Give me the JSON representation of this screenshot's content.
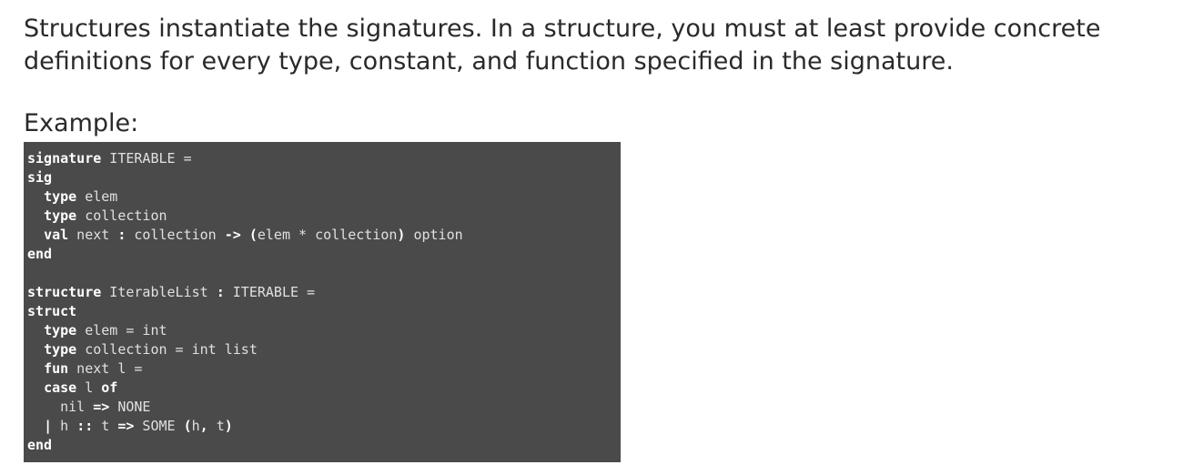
{
  "intro_text": "Structures instantiate the signatures. In a structure, you must at least provide concrete definitions for every type, constant, and function specified in the signature.",
  "example_label": "Example:",
  "code_lines": [
    [
      {
        "kw": true,
        "text": "signature"
      },
      {
        "kw": false,
        "text": " ITERABLE ="
      }
    ],
    [
      {
        "kw": true,
        "text": "sig"
      }
    ],
    [
      {
        "kw": false,
        "text": "  "
      },
      {
        "kw": true,
        "text": "type"
      },
      {
        "kw": false,
        "text": " elem"
      }
    ],
    [
      {
        "kw": false,
        "text": "  "
      },
      {
        "kw": true,
        "text": "type"
      },
      {
        "kw": false,
        "text": " collection"
      }
    ],
    [
      {
        "kw": false,
        "text": "  "
      },
      {
        "kw": true,
        "text": "val"
      },
      {
        "kw": false,
        "text": " next "
      },
      {
        "kw": true,
        "text": ":"
      },
      {
        "kw": false,
        "text": " collection "
      },
      {
        "kw": true,
        "text": "->"
      },
      {
        "kw": false,
        "text": " "
      },
      {
        "kw": true,
        "text": "("
      },
      {
        "kw": false,
        "text": "elem * collection"
      },
      {
        "kw": true,
        "text": ")"
      },
      {
        "kw": false,
        "text": " option"
      }
    ],
    [
      {
        "kw": true,
        "text": "end"
      }
    ],
    [],
    [
      {
        "kw": true,
        "text": "structure"
      },
      {
        "kw": false,
        "text": " IterableList "
      },
      {
        "kw": true,
        "text": ":"
      },
      {
        "kw": false,
        "text": " ITERABLE ="
      }
    ],
    [
      {
        "kw": true,
        "text": "struct"
      }
    ],
    [
      {
        "kw": false,
        "text": "  "
      },
      {
        "kw": true,
        "text": "type"
      },
      {
        "kw": false,
        "text": " elem = int"
      }
    ],
    [
      {
        "kw": false,
        "text": "  "
      },
      {
        "kw": true,
        "text": "type"
      },
      {
        "kw": false,
        "text": " collection = int list"
      }
    ],
    [
      {
        "kw": false,
        "text": "  "
      },
      {
        "kw": true,
        "text": "fun"
      },
      {
        "kw": false,
        "text": " next l ="
      }
    ],
    [
      {
        "kw": false,
        "text": "  "
      },
      {
        "kw": true,
        "text": "case"
      },
      {
        "kw": false,
        "text": " l "
      },
      {
        "kw": true,
        "text": "of"
      }
    ],
    [
      {
        "kw": false,
        "text": "    nil "
      },
      {
        "kw": true,
        "text": "=>"
      },
      {
        "kw": false,
        "text": " NONE"
      }
    ],
    [
      {
        "kw": false,
        "text": "  "
      },
      {
        "kw": true,
        "text": "|"
      },
      {
        "kw": false,
        "text": " h "
      },
      {
        "kw": true,
        "text": "::"
      },
      {
        "kw": false,
        "text": " t "
      },
      {
        "kw": true,
        "text": "=>"
      },
      {
        "kw": false,
        "text": " SOME "
      },
      {
        "kw": true,
        "text": "("
      },
      {
        "kw": false,
        "text": "h"
      },
      {
        "kw": true,
        "text": ","
      },
      {
        "kw": false,
        "text": " t"
      },
      {
        "kw": true,
        "text": ")"
      }
    ],
    [
      {
        "kw": true,
        "text": "end"
      }
    ]
  ]
}
